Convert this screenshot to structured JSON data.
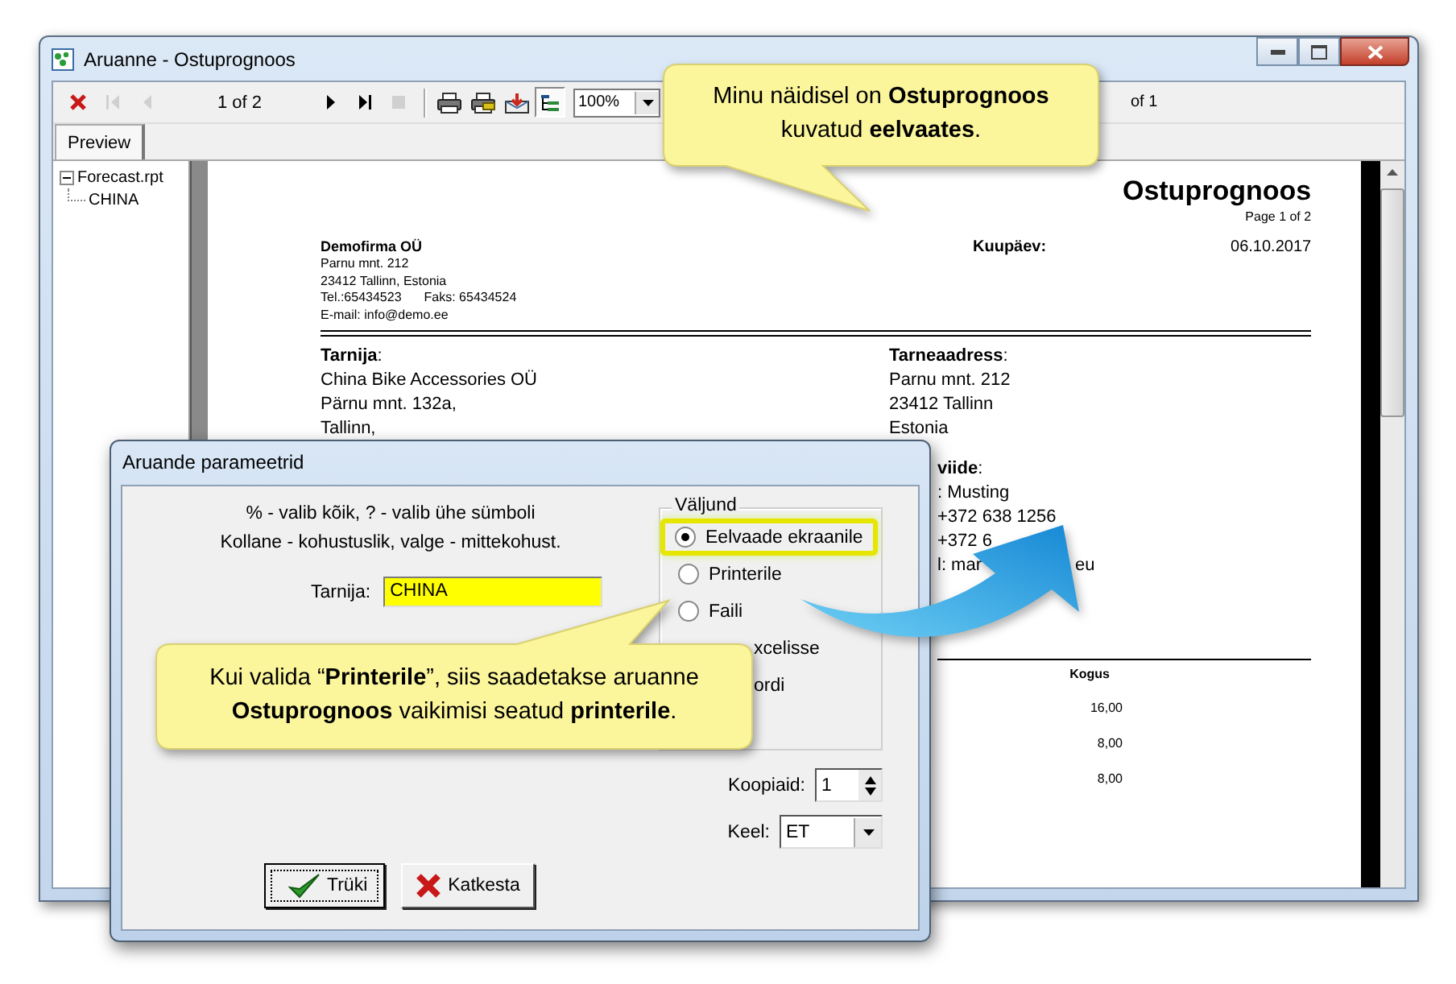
{
  "window": {
    "title": "Aruanne - Ostuprognoos"
  },
  "toolbar": [
    {
      "kind": "close",
      "disabled": false
    },
    {
      "kind": "first",
      "disabled": true
    },
    {
      "kind": "prev",
      "disabled": true
    },
    {
      "kind": "page",
      "text": "1 of 2"
    },
    {
      "kind": "next",
      "disabled": false
    },
    {
      "kind": "last",
      "disabled": false
    },
    {
      "kind": "stop",
      "disabled": true
    },
    {
      "kind": "separator"
    },
    {
      "kind": "print",
      "disabled": false
    },
    {
      "kind": "print-setup",
      "disabled": false
    },
    {
      "kind": "export",
      "disabled": false
    },
    {
      "kind": "tree",
      "disabled": false,
      "on": true
    },
    {
      "kind": "zoom",
      "text": "100%"
    },
    {
      "kind": "page2",
      "text": "of 1"
    }
  ],
  "tabs": [
    {
      "label": "Preview",
      "selected": true
    }
  ],
  "tree": [
    {
      "label": "Forecast.rpt",
      "expanded": true,
      "children": [
        {
          "label": "CHINA"
        }
      ]
    }
  ],
  "report": {
    "title": "Ostuprognoos",
    "page": "Page 1 of 2",
    "company": {
      "name": "Demofirma OÜ",
      "address": [
        "Parnu mnt. 212",
        "23412 Tallinn, Estonia"
      ],
      "phone": "Tel.:65434523",
      "fax": "Faks:  65434524",
      "email": "E-mail: info@demo.ee"
    },
    "date_label": "Kuupäev:",
    "date": "06.10.2017",
    "supplier": {
      "label": "**Tarnija**:",
      "lines": [
        "China Bike Accessories OÜ",
        "Pärnu mnt. 132a,",
        "Tallinn,"
      ]
    },
    "delivery": {
      "label": "**Tarneaadress**:",
      "lines": [
        "Parnu mnt. 212",
        "23412 Tallinn",
        "Estonia"
      ]
    },
    "contact": {
      "label": "**viide**:",
      "lines": [
        ": Musting",
        "+372 638 1256",
        "+372 6",
        "l: mar"
      ],
      "tail": "eu"
    },
    "table": {
      "column": "Kogus",
      "values": [
        "16,00",
        "8,00",
        "8,00"
      ]
    }
  },
  "dialog": {
    "title": "Aruande parameetrid",
    "hints": [
      "% - valib kõik, ? - valib ühe sümboli",
      "Kollane - kohustuslik, valge - mittekohust."
    ],
    "supplier_label": "Tarnija:",
    "supplier_value": "CHINA",
    "output_legend": "Väljund",
    "options": [
      {
        "kind": "radio",
        "label": "Eelvaade ekraanile",
        "selected": true
      },
      {
        "kind": "radio",
        "label": "Printerile",
        "selected": false
      },
      {
        "kind": "radio",
        "label": "Faili",
        "selected": false
      },
      {
        "kind": "partial",
        "label": "xcelisse"
      },
      {
        "kind": "partial",
        "label": "ordi"
      }
    ],
    "copies_label": "Koopiaid:",
    "copies_value": "1",
    "language_label": "Keel:",
    "language_value": "ET",
    "buttons": [
      {
        "kind": "ok",
        "label": "Trüki"
      },
      {
        "kind": "cancel",
        "label": "Katkesta"
      }
    ]
  },
  "callouts": [
    {
      "text": "Minu näidisel on **Ostuprognoos** kuvatud **eelvaates**."
    },
    {
      "text": "Kui valida “**Printerile**”, siis saadetakse aruanne **Ostuprognoos** vaikimisi seatud **printerile**."
    }
  ]
}
